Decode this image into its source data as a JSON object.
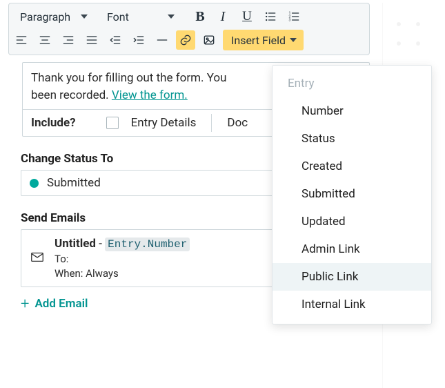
{
  "toolbar": {
    "paragraph": "Paragraph",
    "font": "Font",
    "insert_field": "Insert Field"
  },
  "editor": {
    "body_line1": "Thank you for filling out the form. You",
    "body_line2": "been recorded. ",
    "view_link": "View the form.",
    "include_label": "Include?",
    "include_opt_entry_details": "Entry Details",
    "include_opt_doc": "Doc"
  },
  "status": {
    "heading": "Change Status To",
    "value": "Submitted"
  },
  "emails": {
    "heading": "Send Emails",
    "item": {
      "title_untitled": "Untitled",
      "title_dash": " - ",
      "code": "Entry.Number",
      "to_label": "To:",
      "when_label": "When: ",
      "when_value": "Always"
    },
    "add_label": "Add Email"
  },
  "menu": {
    "heading": "Entry",
    "items": [
      "Number",
      "Status",
      "Created",
      "Submitted",
      "Updated",
      "Admin Link",
      "Public Link",
      "Internal Link"
    ],
    "hover_index": 6
  }
}
